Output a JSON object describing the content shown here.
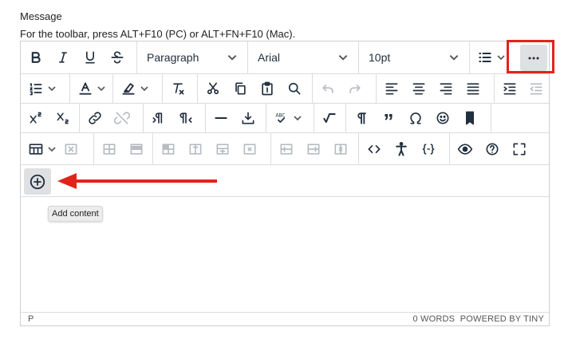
{
  "labels": {
    "field_label": "Message",
    "toolbar_hint": "For the toolbar, press ALT+F10 (PC) or ALT+FN+F10 (Mac)."
  },
  "toolbar": {
    "block_format": "Paragraph",
    "font_family": "Arial",
    "font_size": "10pt",
    "more_button": "more-icon"
  },
  "insert": {
    "add_content_tooltip": "Add content"
  },
  "statusbar": {
    "path": "P",
    "word_count": "0 WORDS",
    "branding": "POWERED BY TINY"
  },
  "colors": {
    "highlight_box": "#e2231a",
    "arrow": "#e2231a",
    "active_button_bg": "#dee0e2"
  }
}
